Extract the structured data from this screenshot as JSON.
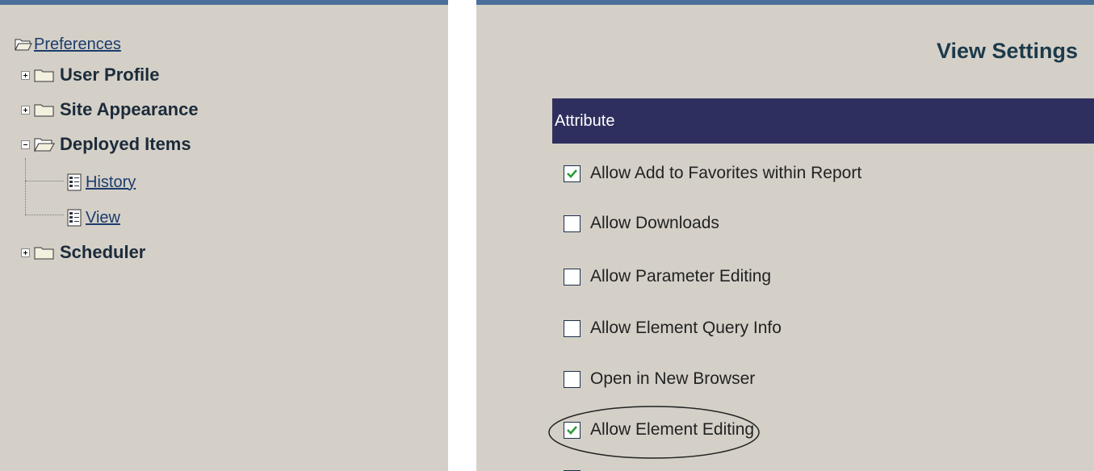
{
  "tree": {
    "root_label": "Preferences",
    "items": [
      {
        "label": "User Profile",
        "expanded": false
      },
      {
        "label": "Site Appearance",
        "expanded": false
      },
      {
        "label": "Deployed Items",
        "expanded": true,
        "children": [
          "History",
          "View"
        ]
      },
      {
        "label": "Scheduler",
        "expanded": false
      }
    ]
  },
  "settings": {
    "title": "View Settings",
    "header": "Attribute",
    "options": [
      {
        "label": "Allow Add to Favorites within Report",
        "checked": true
      },
      {
        "label": "Allow Downloads",
        "checked": false
      },
      {
        "label": "Allow Parameter Editing",
        "checked": false
      },
      {
        "label": "Allow Element Query Info",
        "checked": false
      },
      {
        "label": "Open in New Browser",
        "checked": false
      },
      {
        "label": "Allow Element Editing",
        "checked": true,
        "circled": true
      }
    ]
  },
  "colors": {
    "pane_background": "#d4d0c8",
    "pane_top_border": "#4a6f9a",
    "header_background": "#2f2f5f",
    "checkmark": "#2e9b3a"
  }
}
